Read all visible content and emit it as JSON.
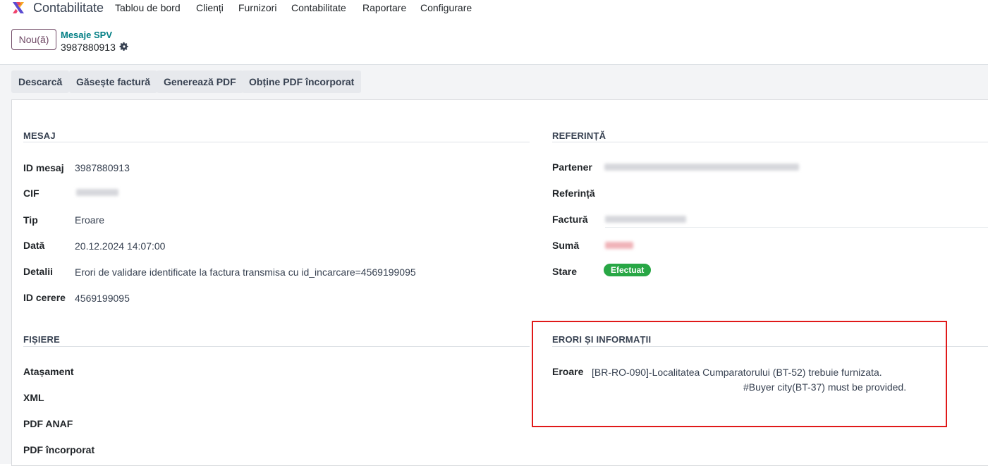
{
  "navbar": {
    "app_name": "Contabilitate",
    "menu": [
      "Tablou de bord",
      "Clienți",
      "Furnizori",
      "Contabilitate",
      "Raportare",
      "Configurare"
    ]
  },
  "control_panel": {
    "new_label": "Nou(ă)",
    "breadcrumb": "Mesaje SPV",
    "record_name": "3987880913",
    "gear_icon": "gear-icon"
  },
  "actions": [
    "Descarcă",
    "Găsește factură",
    "Generează PDF",
    "Obține PDF încorporat"
  ],
  "mesaj": {
    "title": "MESAJ",
    "fields": [
      {
        "label": "ID mesaj",
        "value": "3987880913"
      },
      {
        "label": "CIF",
        "value": ""
      },
      {
        "label": "Tip",
        "value": "Eroare"
      },
      {
        "label": "Dată",
        "value": "20.12.2024 14:07:00"
      },
      {
        "label": "Detalii",
        "value": "Erori de validare identificate la factura transmisa cu id_incarcare=4569199095"
      },
      {
        "label": "ID cerere",
        "value": "4569199095"
      }
    ]
  },
  "referinta": {
    "title": "REFERINȚĂ",
    "fields": [
      {
        "label": "Partener",
        "value": ""
      },
      {
        "label": "Referință",
        "value": ""
      },
      {
        "label": "Factură",
        "value": ""
      },
      {
        "label": "Sumă",
        "value": ""
      },
      {
        "label": "Stare",
        "value": "Efectuat"
      }
    ],
    "status_color": "#28a745"
  },
  "fisiere": {
    "title": "FIȘIERE",
    "fields": [
      "Atașament",
      "XML",
      "PDF ANAF",
      "PDF încorporat"
    ]
  },
  "erori": {
    "title": "ERORI ȘI INFORMAȚII",
    "label": "Eroare",
    "line1": "[BR-RO-090]-Localitatea Cumparatorului (BT-52) trebuie furnizata.",
    "line2": "#Buyer city(BT-37) must be provided.",
    "highlight_color": "#e01919"
  }
}
